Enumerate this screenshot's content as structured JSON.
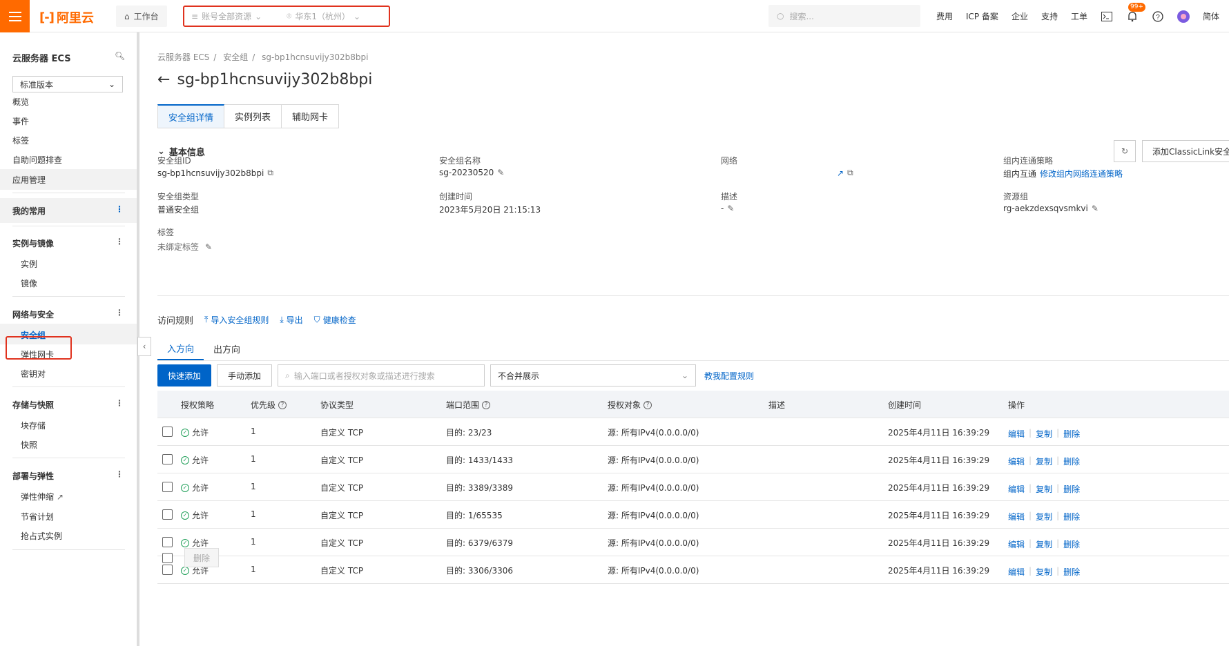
{
  "topbar": {
    "logo_text": "阿里云",
    "workbench_label": "工作台",
    "resource_scope": "账号全部资源",
    "region": "华东1（杭州）",
    "search_placeholder": "搜索...",
    "links": [
      "费用",
      "ICP 备案",
      "企业",
      "支持",
      "工单"
    ],
    "notif_badge": "99+",
    "lang": "简体"
  },
  "sidebar": {
    "title": "云服务器 ECS",
    "version_select": "标准版本",
    "items": [
      "概览",
      "事件",
      "标签",
      "自助问题排查",
      "应用管理"
    ],
    "favorites": "我的常用",
    "groups": [
      {
        "title": "实例与镜像",
        "items": [
          "实例",
          "镜像"
        ]
      },
      {
        "title": "网络与安全",
        "items": [
          "安全组",
          "弹性网卡",
          "密钥对"
        ]
      },
      {
        "title": "存储与快照",
        "items": [
          "块存储",
          "快照"
        ]
      },
      {
        "title": "部署与弹性",
        "items": [
          "弹性伸缩",
          "节省计划",
          "抢占式实例"
        ]
      }
    ]
  },
  "breadcrumb": [
    "云服务器 ECS",
    "安全组",
    "sg-bp1hcnsuvijy302b8bpi"
  ],
  "page_title": "sg-bp1hcnsuvijy302b8bpi",
  "tabs": [
    "安全组详情",
    "实例列表",
    "辅助网卡"
  ],
  "basic_info": {
    "section_title": "基本信息",
    "classic_btn": "添加ClassicLink安全组规则",
    "fields": {
      "sg_id_label": "安全组ID",
      "sg_id": "sg-bp1hcnsuvijy302b8bpi",
      "sg_name_label": "安全组名称",
      "sg_name": "sg-20230520",
      "network_label": "网络",
      "policy_label": "组内连通策略",
      "policy_value": "组内互通",
      "policy_link": "修改组内网络连通策略",
      "type_label": "安全组类型",
      "type_value": "普通安全组",
      "created_label": "创建时间",
      "created_value": "2023年5月20日 21:15:13",
      "desc_label": "描述",
      "desc_value": "-",
      "rg_label": "资源组",
      "rg_value": "rg-aekzdexsqvsmkvi",
      "tag_label": "标签",
      "tag_value": "未绑定标签"
    }
  },
  "rules": {
    "title": "访问规则",
    "actions": [
      "导入安全组规则",
      "导出",
      "健康检查"
    ],
    "directions": [
      "入方向",
      "出方向"
    ],
    "quick_add": "快速添加",
    "manual_add": "手动添加",
    "search_placeholder": "输入端口或者授权对象或描述进行搜索",
    "merge_select": "不合并展示",
    "teach_link": "教我配置规则",
    "columns": [
      "授权策略",
      "优先级",
      "协议类型",
      "端口范围",
      "授权对象",
      "描述",
      "创建时间",
      "操作"
    ],
    "rows": [
      {
        "policy": "允许",
        "priority": "1",
        "protocol": "自定义 TCP",
        "port": "目的: 23/23",
        "target": "源: 所有IPv4(0.0.0.0/0)",
        "desc": "",
        "created": "2025年4月11日 16:39:29"
      },
      {
        "policy": "允许",
        "priority": "1",
        "protocol": "自定义 TCP",
        "port": "目的: 1433/1433",
        "target": "源: 所有IPv4(0.0.0.0/0)",
        "desc": "",
        "created": "2025年4月11日 16:39:29"
      },
      {
        "policy": "允许",
        "priority": "1",
        "protocol": "自定义 TCP",
        "port": "目的: 3389/3389",
        "target": "源: 所有IPv4(0.0.0.0/0)",
        "desc": "",
        "created": "2025年4月11日 16:39:29"
      },
      {
        "policy": "允许",
        "priority": "1",
        "protocol": "自定义 TCP",
        "port": "目的: 1/65535",
        "target": "源: 所有IPv4(0.0.0.0/0)",
        "desc": "",
        "created": "2025年4月11日 16:39:29"
      },
      {
        "policy": "允许",
        "priority": "1",
        "protocol": "自定义 TCP",
        "port": "目的: 6379/6379",
        "target": "源: 所有IPv4(0.0.0.0/0)",
        "desc": "",
        "created": "2025年4月11日 16:39:29"
      },
      {
        "policy": "允许",
        "priority": "1",
        "protocol": "自定义 TCP",
        "port": "目的: 3306/3306",
        "target": "源: 所有IPv4(0.0.0.0/0)",
        "desc": "",
        "created": "2025年4月11日 16:39:29"
      }
    ],
    "row_actions": [
      "编辑",
      "复制",
      "删除"
    ],
    "footer_delete": "删除"
  },
  "colors": {
    "brand": "#ff6a00",
    "primary": "#0064c8",
    "highlight": "#e0321e",
    "success": "#22a05a"
  }
}
